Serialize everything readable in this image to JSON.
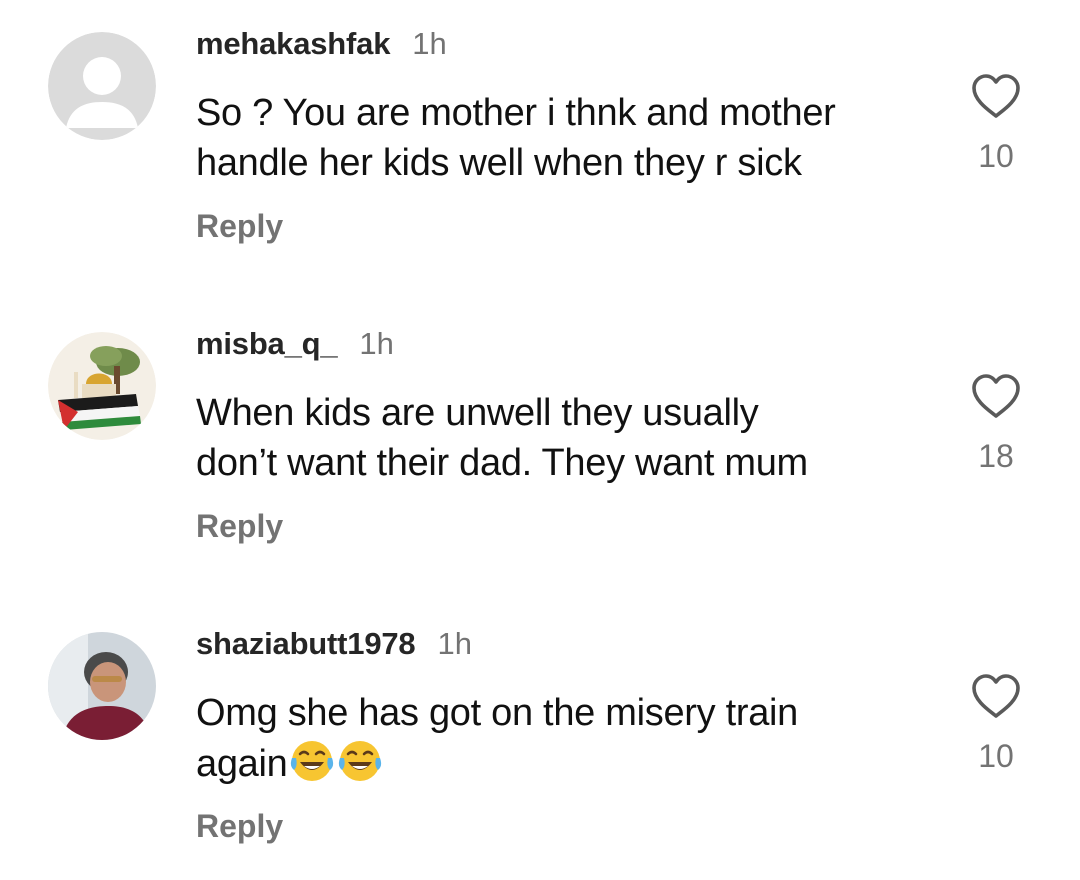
{
  "comments": [
    {
      "username": "mehakashfak",
      "time": "1h",
      "text": "So ? You are mother i thnk and mother\nhandle her kids well when they r sick",
      "emojis": [],
      "reply_label": "Reply",
      "likes": "10",
      "avatar": "default-avatar"
    },
    {
      "username": "misba_q_",
      "time": "1h",
      "text": "When kids are unwell they usually\ndon’t want their dad. They want mum",
      "emojis": [],
      "reply_label": "Reply",
      "likes": "18",
      "avatar": "mosque-flag-avatar"
    },
    {
      "username": "shaziabutt1978",
      "time": "1h",
      "text": "Omg she has got on the misery train\nagain",
      "emojis": [
        "face-with-tears-of-joy",
        "face-with-tears-of-joy"
      ],
      "reply_label": "Reply",
      "likes": "10",
      "avatar": "user-photo-avatar"
    }
  ],
  "colors": {
    "username": "#262626",
    "secondary": "#737373",
    "text": "#111111",
    "background": "#ffffff"
  },
  "icons": {
    "like": "heart-outline-icon",
    "emoji": "face-with-tears-of-joy"
  }
}
